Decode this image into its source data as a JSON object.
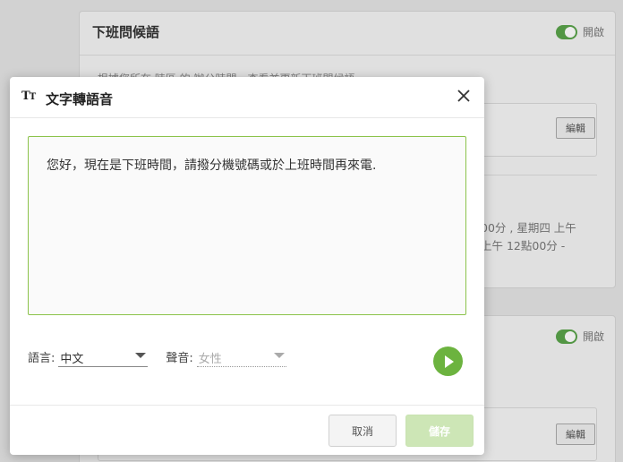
{
  "background": {
    "card1": {
      "title": "下班問候語",
      "toggle_label": "開啟",
      "description": "根據您所在 時區 的 辦公時間，查看並更新下班問候語。",
      "edit_label": "編輯",
      "schedule_line1": "00分 , 星期四 上午",
      "schedule_line2": "上午 12點00分 -"
    },
    "card2": {
      "toggle_label": "開啟",
      "edit_label": "編輯"
    }
  },
  "modal": {
    "icon": "text-size-icon",
    "icon_glyph": "T",
    "icon_glyph_small": "T",
    "title": "文字轉語音",
    "text": "您好，現在是下班時間，請撥分機號碼或於上班時間再來電.",
    "language_label": "語言:",
    "language_value": "中文",
    "voice_label": "聲音:",
    "voice_value": "女性",
    "cancel_label": "取消",
    "save_label": "儲存"
  },
  "colors": {
    "accent_green": "#6cb33f",
    "textarea_border": "#8bc34a",
    "save_disabled": "#cde6b6"
  }
}
